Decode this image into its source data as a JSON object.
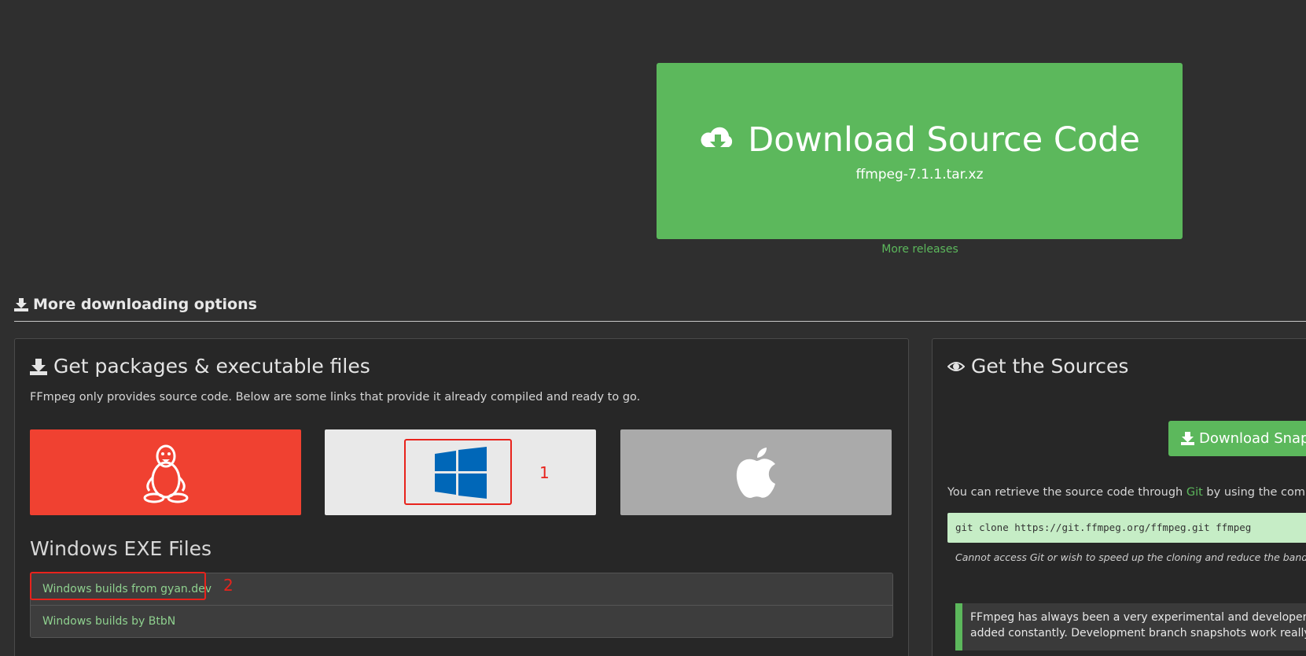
{
  "hero": {
    "title": "Download Source Code",
    "filename": "ffmpeg-7.1.1.tar.xz",
    "more_releases": "More releases"
  },
  "section": {
    "title": "More downloading options"
  },
  "packages": {
    "title": "Get packages & executable files",
    "intro": "FFmpeg only provides source code. Below are some links that provide it already compiled and ready to go.",
    "os_tiles": [
      "linux",
      "windows",
      "mac"
    ],
    "annotation_1": "1",
    "exe_title": "Windows EXE Files",
    "exe_links": [
      "Windows builds from gyan.dev",
      "Windows builds by BtbN"
    ],
    "annotation_2": "2"
  },
  "sources": {
    "title": "Get the Sources",
    "snapshot_button": "Download Snap",
    "retrieve_prefix": "You can retrieve the source code through ",
    "git_link": "Git",
    "retrieve_suffix": " by using the comman",
    "git_command": "git clone https://git.ffmpeg.org/ffmpeg.git ffmpeg",
    "bandwidth_note": "Cannot access Git or wish to speed up the cloning and reduce the bandwidth",
    "callout_line1": "FFmpeg has always been a very experimental and developer-",
    "callout_line2": "added constantly. Development branch snapshots work really w"
  },
  "colors": {
    "background": "#2f2f2f",
    "accent_green": "#5cb85c",
    "linux_red": "#f04131",
    "windows_tile": "#e9e9e9",
    "mac_tile": "#aaaaaa",
    "windows_blue": "#0067b8",
    "annotation_red": "#e8231c"
  }
}
